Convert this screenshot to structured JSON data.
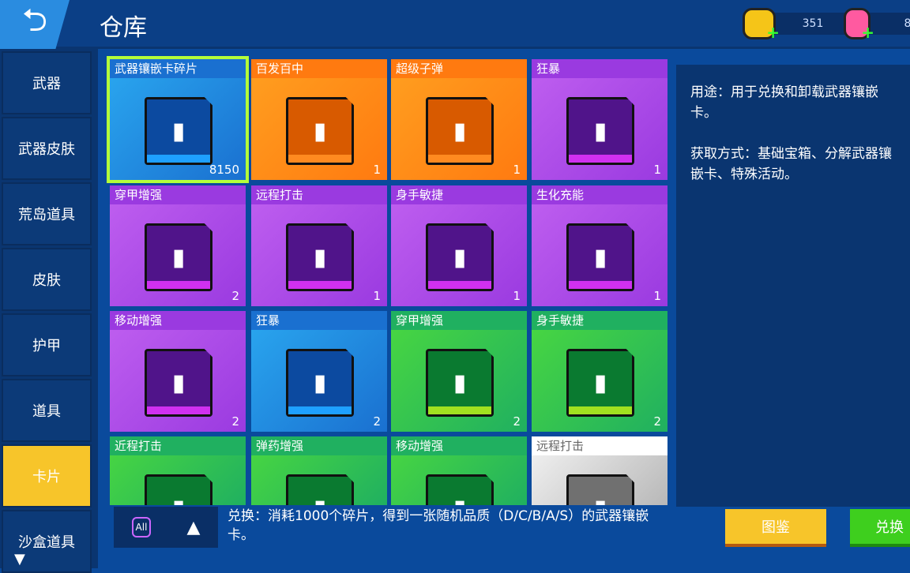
{
  "header": {
    "title": "仓库",
    "back_icon": "back-arrow-icon"
  },
  "currency": [
    {
      "icon": "coin-icon",
      "value": "351",
      "color": "#f5c518"
    },
    {
      "icon": "gem-icon",
      "value": "8",
      "color": "#ff5aa0"
    }
  ],
  "sidebar": {
    "items": [
      {
        "label": "武器"
      },
      {
        "label": "武器皮肤"
      },
      {
        "label": "荒岛道具"
      },
      {
        "label": "皮肤"
      },
      {
        "label": "护甲"
      },
      {
        "label": "道具"
      },
      {
        "label": "卡片",
        "active": true
      },
      {
        "label": "沙盒道具"
      }
    ]
  },
  "cards": [
    {
      "name": "武器镶嵌卡碎片",
      "count": "8150",
      "rarity": "blue",
      "selected": true
    },
    {
      "name": "百发百中",
      "count": "1",
      "rarity": "orange"
    },
    {
      "name": "超级子弹",
      "count": "1",
      "rarity": "orange"
    },
    {
      "name": "狂暴",
      "count": "1",
      "rarity": "purple"
    },
    {
      "name": "穿甲增强",
      "count": "2",
      "rarity": "purple"
    },
    {
      "name": "远程打击",
      "count": "1",
      "rarity": "purple"
    },
    {
      "name": "身手敏捷",
      "count": "1",
      "rarity": "purple"
    },
    {
      "name": "生化充能",
      "count": "1",
      "rarity": "purple"
    },
    {
      "name": "移动增强",
      "count": "2",
      "rarity": "purple"
    },
    {
      "name": "狂暴",
      "count": "2",
      "rarity": "blue"
    },
    {
      "name": "穿甲增强",
      "count": "2",
      "rarity": "green"
    },
    {
      "name": "身手敏捷",
      "count": "2",
      "rarity": "green"
    },
    {
      "name": "近程打击",
      "count": "",
      "rarity": "green"
    },
    {
      "name": "弹药增强",
      "count": "",
      "rarity": "green"
    },
    {
      "name": "移动增强",
      "count": "",
      "rarity": "green"
    },
    {
      "name": "远程打击",
      "count": "",
      "rarity": "grey"
    }
  ],
  "info": {
    "usage": "用途：用于兑换和卸载武器镶嵌卡。",
    "obtain": "获取方式：基础宝箱、分解武器镶嵌卡、特殊活动。"
  },
  "footer": {
    "filter_label": "All",
    "exchange_text": "兑换：消耗1000个碎片，得到一张随机品质（D/C/B/A/S）的武器镶嵌卡。",
    "catalog_button": "图鉴",
    "exchange_button": "兑换"
  }
}
